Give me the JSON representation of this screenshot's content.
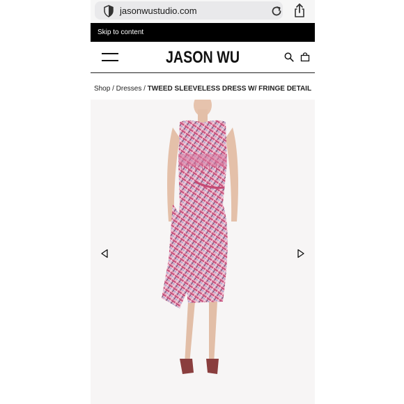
{
  "browser": {
    "url": "jasonwustudio.com"
  },
  "skip_link": "Skip to content",
  "header": {
    "logo": "JASON WU"
  },
  "breadcrumb": {
    "shop": "Shop",
    "sep1": " / ",
    "dresses": "Dresses",
    "sep2": " / ",
    "product": "TWEED SLEEVELESS DRESS W/ FRINGE DETAIL"
  },
  "icons": {
    "security": "shield-icon",
    "reload": "reload-icon",
    "share": "share-icon",
    "menu": "hamburger-icon",
    "search": "search-icon",
    "bag": "shopping-bag-icon",
    "prev": "previous-arrow-icon",
    "next": "next-arrow-icon"
  },
  "colors": {
    "skip_bar": "#000000",
    "dress_pink": "#e9a7be"
  }
}
